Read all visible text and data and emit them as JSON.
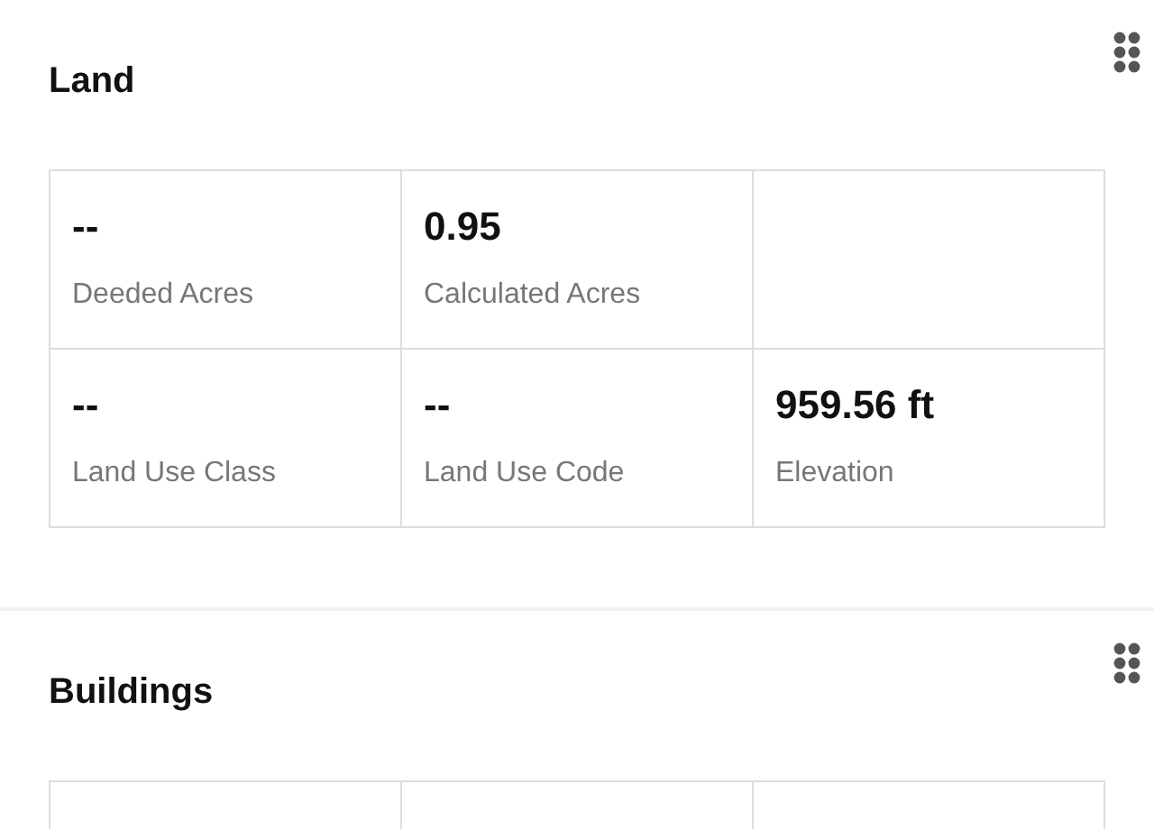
{
  "sections": [
    {
      "title": "Land",
      "cells": [
        {
          "value": "--",
          "label": "Deeded Acres"
        },
        {
          "value": "0.95",
          "label": "Calculated Acres"
        },
        {},
        {
          "value": "--",
          "label": "Land Use Class"
        },
        {
          "value": "--",
          "label": "Land Use Code"
        },
        {
          "value": "959.56 ft",
          "label": "Elevation"
        }
      ]
    },
    {
      "title": "Buildings",
      "cells": [
        {},
        {},
        {}
      ]
    }
  ]
}
